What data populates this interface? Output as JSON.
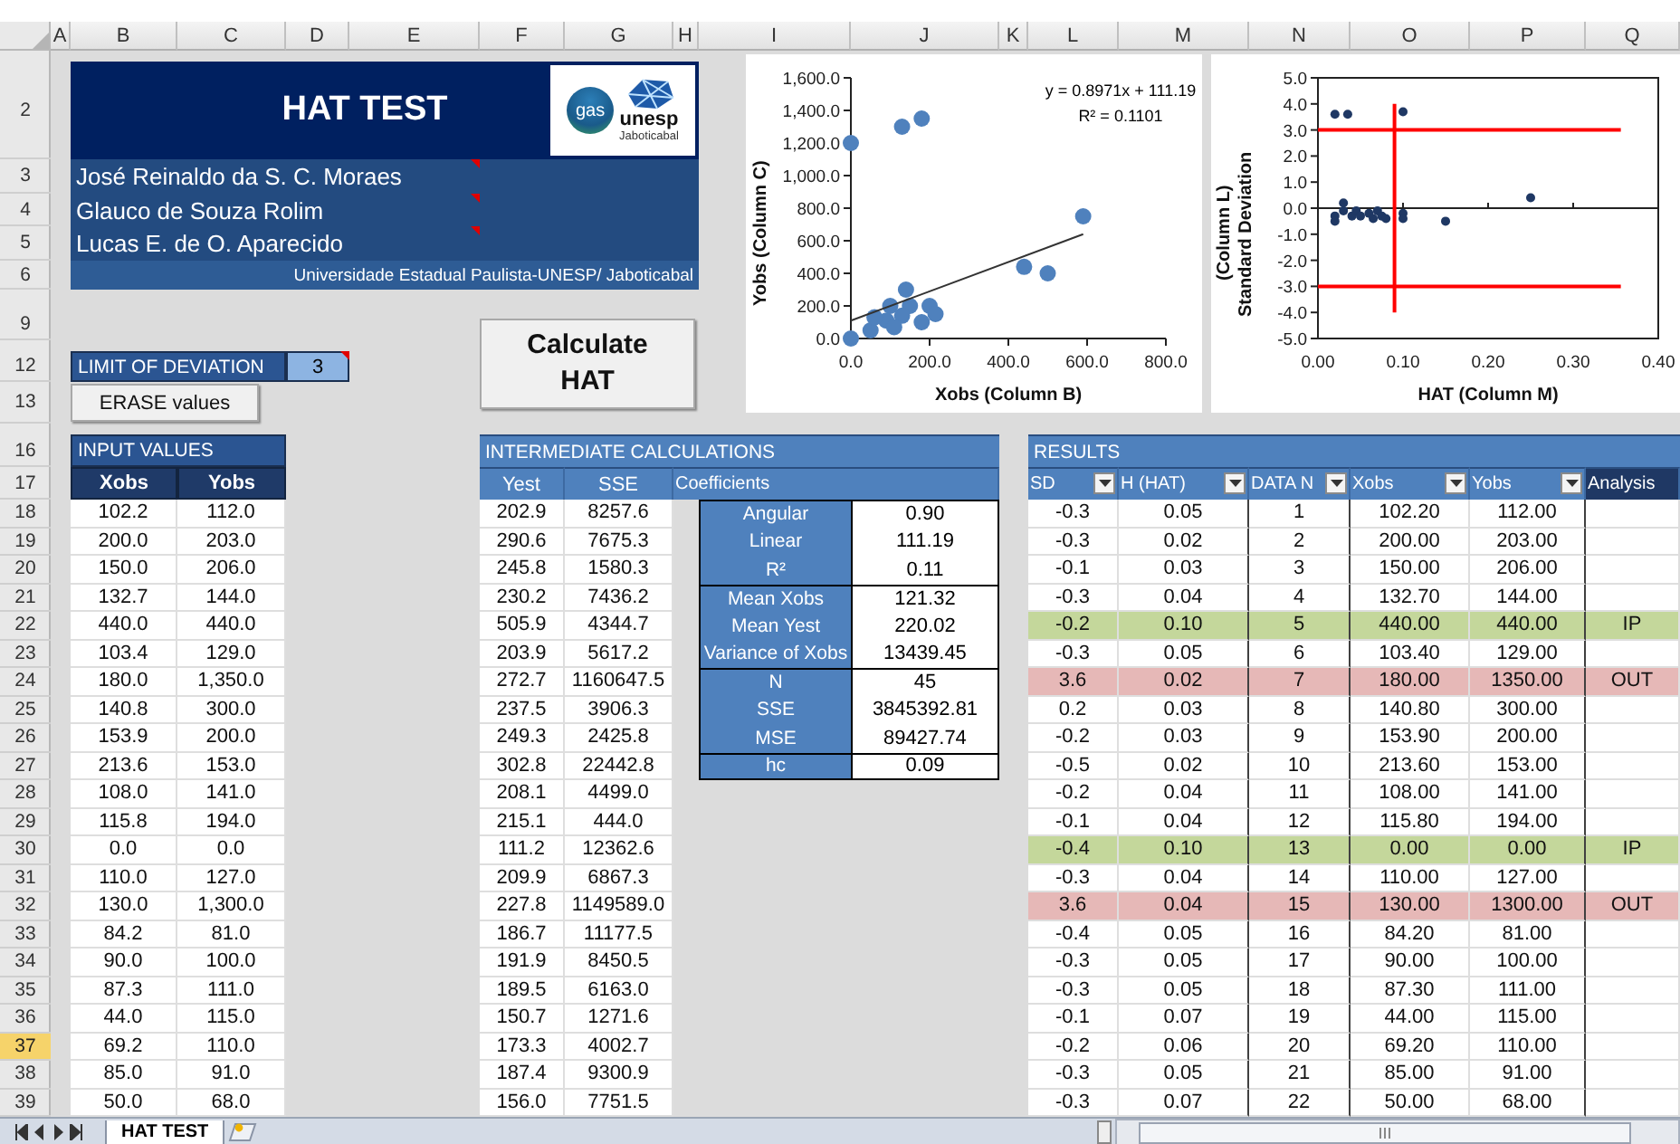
{
  "columns": [
    "A",
    "B",
    "C",
    "D",
    "E",
    "F",
    "G",
    "H",
    "I",
    "J",
    "K",
    "L",
    "M",
    "N",
    "O",
    "P",
    "Q"
  ],
  "row_headers": [
    {
      "label": "2",
      "selected": false
    },
    {
      "label": "3",
      "selected": false
    },
    {
      "label": "4",
      "selected": false
    },
    {
      "label": "5",
      "selected": false
    },
    {
      "label": "6",
      "selected": false
    },
    {
      "label": "9",
      "selected": false
    },
    {
      "label": "12",
      "selected": false
    },
    {
      "label": "13",
      "selected": false
    },
    {
      "label": "16",
      "selected": false
    },
    {
      "label": "17",
      "selected": false
    },
    {
      "label": "18",
      "selected": false
    },
    {
      "label": "19",
      "selected": false
    },
    {
      "label": "20",
      "selected": false
    },
    {
      "label": "21",
      "selected": false
    },
    {
      "label": "22",
      "selected": false
    },
    {
      "label": "23",
      "selected": false
    },
    {
      "label": "24",
      "selected": false
    },
    {
      "label": "25",
      "selected": false
    },
    {
      "label": "26",
      "selected": false
    },
    {
      "label": "27",
      "selected": false
    },
    {
      "label": "28",
      "selected": false
    },
    {
      "label": "29",
      "selected": false
    },
    {
      "label": "30",
      "selected": false
    },
    {
      "label": "31",
      "selected": false
    },
    {
      "label": "32",
      "selected": false
    },
    {
      "label": "33",
      "selected": false
    },
    {
      "label": "34",
      "selected": false
    },
    {
      "label": "35",
      "selected": false
    },
    {
      "label": "36",
      "selected": false
    },
    {
      "label": "37",
      "selected": true
    },
    {
      "label": "38",
      "selected": false
    },
    {
      "label": "39",
      "selected": false
    }
  ],
  "title_block": {
    "title": "HAT TEST",
    "logo": {
      "left": "gas",
      "right": "unesp",
      "right_sub": "Jaboticabal"
    },
    "authors": [
      {
        "name": "José Reinaldo da S. C. Moraes",
        "has_comment": true
      },
      {
        "name": "Glauco de Souza Rolim",
        "has_comment": true
      },
      {
        "name": "Lucas E. de O. Aparecido",
        "has_comment": true
      }
    ],
    "institution": "Universidade Estadual Paulista-UNESP/ Jaboticabal"
  },
  "limit": {
    "label": "LIMIT OF DEVIATION",
    "value": "3",
    "has_comment": true
  },
  "buttons": [
    {
      "kind": "erase",
      "label": "ERASE values"
    },
    {
      "kind": "calculate",
      "label": "Calculate HAT"
    }
  ],
  "scatter_chart": {
    "chart_data": {
      "type": "scatter",
      "xlabel": "Xobs (Column B)",
      "ylabel": "Yobs (Column C)",
      "xlim": [
        0,
        800
      ],
      "ylim": [
        0,
        1600
      ],
      "xticks": [
        {
          "value": 0,
          "label": "0.0"
        },
        {
          "value": 200,
          "label": "200.0"
        },
        {
          "value": 400,
          "label": "400.0"
        },
        {
          "value": 600,
          "label": "600.0"
        },
        {
          "value": 800,
          "label": "800.0"
        }
      ],
      "yticks": [
        {
          "value": 0,
          "label": "0.0"
        },
        {
          "value": 200,
          "label": "200.0"
        },
        {
          "value": 400,
          "label": "400.0"
        },
        {
          "value": 600,
          "label": "600.0"
        },
        {
          "value": 800,
          "label": "800.0"
        },
        {
          "value": 1000,
          "label": "1,000.0"
        },
        {
          "value": 1200,
          "label": "1,200.0"
        },
        {
          "value": 1400,
          "label": "1,400.0"
        },
        {
          "value": 1600,
          "label": "1,600.0"
        }
      ],
      "x": [
        0,
        0,
        130,
        180,
        590,
        500,
        440,
        140,
        200,
        215,
        180,
        150,
        100,
        130,
        90,
        50,
        60,
        110
      ],
      "series": [
        {
          "color": "#4f81bd",
          "values": [
            0,
            1200,
            1300,
            1350,
            750,
            400,
            440,
            300,
            200,
            150,
            100,
            200,
            200,
            140,
            110,
            50,
            130,
            70
          ]
        },
        {
          "type": "line",
          "color": "#333333",
          "x": [
            0,
            590
          ],
          "values": [
            110,
            640
          ]
        }
      ],
      "annotations": [
        {
          "text": "y = 0.8971x + 111.19"
        },
        {
          "text": "R² = 0.1101"
        }
      ]
    }
  },
  "hat_chart": {
    "chart_data": {
      "type": "scatter",
      "xlabel": "HAT (Column M)",
      "ylabel": "Standard Deviation (Column L)",
      "xlim": [
        0,
        0.4
      ],
      "ylim": [
        -5,
        5
      ],
      "xticks": [
        {
          "value": 0,
          "label": "0.00"
        },
        {
          "value": 0.1,
          "label": "0.10"
        },
        {
          "value": 0.2,
          "label": "0.20"
        },
        {
          "value": 0.3,
          "label": "0.30"
        },
        {
          "value": 0.4,
          "label": "0.40"
        }
      ],
      "yticks": [
        {
          "value": 5,
          "label": "5.0"
        },
        {
          "value": 4,
          "label": "4.0"
        },
        {
          "value": 3,
          "label": "3.0"
        },
        {
          "value": 2,
          "label": "2.0"
        },
        {
          "value": 1,
          "label": "1.0"
        },
        {
          "value": 0,
          "label": "0.0"
        },
        {
          "value": -1,
          "label": "-1.0"
        },
        {
          "value": -2,
          "label": "-2.0"
        },
        {
          "value": -3,
          "label": "-3.0"
        },
        {
          "value": -4,
          "label": "-4.0"
        },
        {
          "value": -5,
          "label": "-5.0"
        }
      ],
      "x": [
        0.02,
        0.035,
        0.1,
        0.25,
        0.15,
        0.1,
        0.1,
        0.02,
        0.02,
        0.03,
        0.03,
        0.04,
        0.045,
        0.05,
        0.06,
        0.065,
        0.07,
        0.075,
        0.08
      ],
      "series": [
        {
          "color": "#1f3864",
          "values": [
            3.6,
            3.6,
            3.7,
            0.4,
            -0.5,
            -0.2,
            -0.4,
            -0.3,
            -0.5,
            0.2,
            -0.1,
            -0.3,
            -0.1,
            -0.3,
            -0.2,
            -0.4,
            -0.1,
            -0.3,
            -0.4
          ]
        }
      ],
      "ref_lines": [
        {
          "axis": "y",
          "value": 3
        },
        {
          "axis": "y",
          "value": -3
        },
        {
          "axis": "x",
          "value": 0.09
        }
      ]
    }
  },
  "input_values": {
    "title": "INPUT VALUES",
    "columns": [
      "Xobs",
      "Yobs"
    ],
    "rows": [
      [
        "102.2",
        "112.0"
      ],
      [
        "200.0",
        "203.0"
      ],
      [
        "150.0",
        "206.0"
      ],
      [
        "132.7",
        "144.0"
      ],
      [
        "440.0",
        "440.0"
      ],
      [
        "103.4",
        "129.0"
      ],
      [
        "180.0",
        "1,350.0"
      ],
      [
        "140.8",
        "300.0"
      ],
      [
        "153.9",
        "200.0"
      ],
      [
        "213.6",
        "153.0"
      ],
      [
        "108.0",
        "141.0"
      ],
      [
        "115.8",
        "194.0"
      ],
      [
        "0.0",
        "0.0"
      ],
      [
        "110.0",
        "127.0"
      ],
      [
        "130.0",
        "1,300.0"
      ],
      [
        "84.2",
        "81.0"
      ],
      [
        "90.0",
        "100.0"
      ],
      [
        "87.3",
        "111.0"
      ],
      [
        "44.0",
        "115.0"
      ],
      [
        "69.2",
        "110.0"
      ],
      [
        "85.0",
        "91.0"
      ],
      [
        "50.0",
        "68.0"
      ]
    ]
  },
  "intermediate": {
    "title": "INTERMEDIATE CALCULATIONS",
    "columns": [
      "Yest",
      "SSE",
      "Coefficients"
    ],
    "rows": [
      [
        "202.9",
        "8257.6"
      ],
      [
        "290.6",
        "7675.3"
      ],
      [
        "245.8",
        "1580.3"
      ],
      [
        "230.2",
        "7436.2"
      ],
      [
        "505.9",
        "4344.7"
      ],
      [
        "203.9",
        "5617.2"
      ],
      [
        "272.7",
        "1160647.5"
      ],
      [
        "237.5",
        "3906.3"
      ],
      [
        "249.3",
        "2425.8"
      ],
      [
        "302.8",
        "22442.8"
      ],
      [
        "208.1",
        "4499.0"
      ],
      [
        "215.1",
        "444.0"
      ],
      [
        "111.2",
        "12362.6"
      ],
      [
        "209.9",
        "6867.3"
      ],
      [
        "227.8",
        "1149589.0"
      ],
      [
        "186.7",
        "11177.5"
      ],
      [
        "191.9",
        "8450.5"
      ],
      [
        "189.5",
        "6163.0"
      ],
      [
        "150.7",
        "1271.6"
      ],
      [
        "173.3",
        "4002.7"
      ],
      [
        "187.4",
        "9300.9"
      ],
      [
        "156.0",
        "7751.5"
      ]
    ],
    "coefficients": [
      [
        {
          "label": "Angular",
          "value": "0.90"
        },
        {
          "label": "Linear",
          "value": "111.19"
        },
        {
          "label": "R²",
          "value": "0.11"
        }
      ],
      [
        {
          "label": "Mean Xobs",
          "value": "121.32"
        },
        {
          "label": "Mean Yest",
          "value": "220.02"
        },
        {
          "label": "Variance of Xobs",
          "value": "13439.45"
        }
      ],
      [
        {
          "label": "N",
          "value": "45"
        },
        {
          "label": "SSE",
          "value": "3845392.81"
        },
        {
          "label": "MSE",
          "value": "89427.74"
        }
      ],
      [
        {
          "label": "hc",
          "value": "0.09"
        }
      ]
    ]
  },
  "results": {
    "title": "RESULTS",
    "columns": [
      {
        "label": "SD",
        "filter": true
      },
      {
        "label": "H (HAT)",
        "filter": true
      },
      {
        "label": "DATA N",
        "filter": true
      },
      {
        "label": "Xobs",
        "filter": true
      },
      {
        "label": "Yobs",
        "filter": true
      },
      {
        "label": "Analysis",
        "filter": false
      }
    ],
    "rows": [
      {
        "kind": "normal",
        "cells": [
          "-0.3",
          "0.05",
          "1",
          "102.20",
          "112.00"
        ]
      },
      {
        "kind": "normal",
        "cells": [
          "-0.3",
          "0.02",
          "2",
          "200.00",
          "203.00"
        ]
      },
      {
        "kind": "normal",
        "cells": [
          "-0.1",
          "0.03",
          "3",
          "150.00",
          "206.00"
        ]
      },
      {
        "kind": "normal",
        "cells": [
          "-0.3",
          "0.04",
          "4",
          "132.70",
          "144.00"
        ]
      },
      {
        "kind": "ip",
        "cells": [
          "-0.2",
          "0.10",
          "5",
          "440.00",
          "440.00"
        ],
        "analysis": "IP"
      },
      {
        "kind": "normal",
        "cells": [
          "-0.3",
          "0.05",
          "6",
          "103.40",
          "129.00"
        ]
      },
      {
        "kind": "out",
        "cells": [
          "3.6",
          "0.02",
          "7",
          "180.00",
          "1350.00"
        ],
        "analysis": "OUT"
      },
      {
        "kind": "normal",
        "cells": [
          "0.2",
          "0.03",
          "8",
          "140.80",
          "300.00"
        ]
      },
      {
        "kind": "normal",
        "cells": [
          "-0.2",
          "0.03",
          "9",
          "153.90",
          "200.00"
        ]
      },
      {
        "kind": "normal",
        "cells": [
          "-0.5",
          "0.02",
          "10",
          "213.60",
          "153.00"
        ]
      },
      {
        "kind": "normal",
        "cells": [
          "-0.2",
          "0.04",
          "11",
          "108.00",
          "141.00"
        ]
      },
      {
        "kind": "normal",
        "cells": [
          "-0.1",
          "0.04",
          "12",
          "115.80",
          "194.00"
        ]
      },
      {
        "kind": "ip",
        "cells": [
          "-0.4",
          "0.10",
          "13",
          "0.00",
          "0.00"
        ],
        "analysis": "IP"
      },
      {
        "kind": "normal",
        "cells": [
          "-0.3",
          "0.04",
          "14",
          "110.00",
          "127.00"
        ]
      },
      {
        "kind": "out",
        "cells": [
          "3.6",
          "0.04",
          "15",
          "130.00",
          "1300.00"
        ],
        "analysis": "OUT"
      },
      {
        "kind": "normal",
        "cells": [
          "-0.4",
          "0.05",
          "16",
          "84.20",
          "81.00"
        ]
      },
      {
        "kind": "normal",
        "cells": [
          "-0.3",
          "0.05",
          "17",
          "90.00",
          "100.00"
        ]
      },
      {
        "kind": "normal",
        "cells": [
          "-0.3",
          "0.05",
          "18",
          "87.30",
          "111.00"
        ]
      },
      {
        "kind": "normal",
        "cells": [
          "-0.1",
          "0.07",
          "19",
          "44.00",
          "115.00"
        ]
      },
      {
        "kind": "normal",
        "cells": [
          "-0.2",
          "0.06",
          "20",
          "69.20",
          "110.00"
        ]
      },
      {
        "kind": "normal",
        "cells": [
          "-0.3",
          "0.05",
          "21",
          "85.00",
          "91.00"
        ]
      },
      {
        "kind": "normal",
        "cells": [
          "-0.3",
          "0.07",
          "22",
          "50.00",
          "68.00"
        ]
      }
    ]
  },
  "sheet_tabs": [
    {
      "label": "HAT TEST",
      "selected": true
    }
  ]
}
